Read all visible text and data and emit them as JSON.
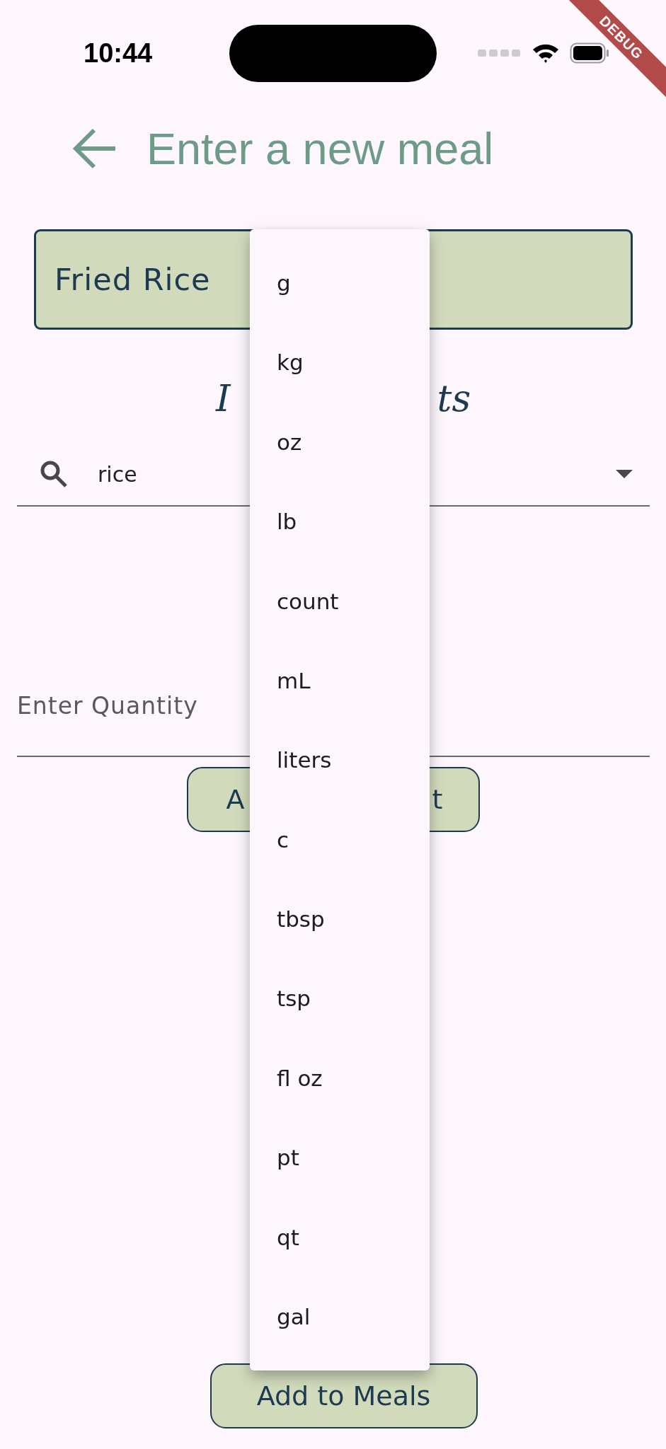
{
  "status_bar": {
    "time": "10:44"
  },
  "debug_banner": "DEBUG",
  "header": {
    "title": "Enter a new meal"
  },
  "meal_name": {
    "value": "Fried Rice"
  },
  "section_title_visible_parts": [
    "I",
    "ts"
  ],
  "ingredient_search": {
    "value": "rice"
  },
  "quantity": {
    "placeholder": "Enter Quantity"
  },
  "add_ingredient_button_visible_parts": [
    "A",
    "t"
  ],
  "unit_menu": {
    "items": [
      "g",
      "kg",
      "oz",
      "lb",
      "count",
      "mL",
      "liters",
      "c",
      "tbsp",
      "tsp",
      "fl oz",
      "pt",
      "qt",
      "gal"
    ]
  },
  "add_meal_button": "Add to Meals"
}
